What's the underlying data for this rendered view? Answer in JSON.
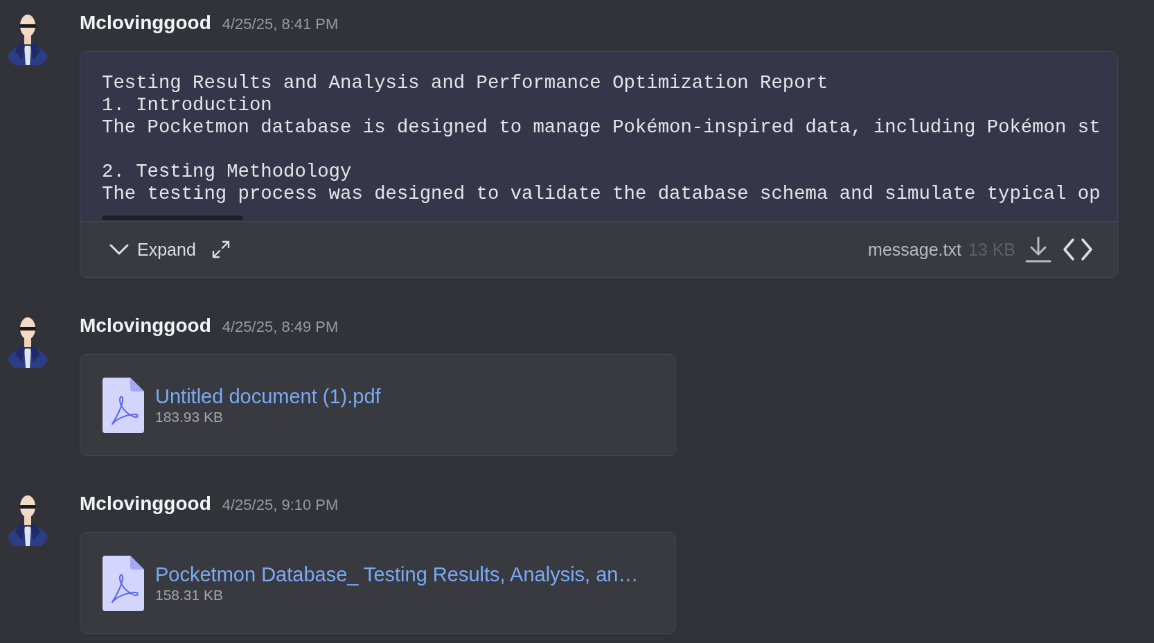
{
  "messages": [
    {
      "author": "Mclovinggood",
      "timestamp": "4/25/25, 8:41 PM",
      "attachment": {
        "kind": "text_preview",
        "sections": [
          {
            "lines": [
              "Testing Results and Analysis and Performance Optimization Report",
              "1. Introduction",
              "The Pocketmon database is designed to manage Pokémon-inspired data, including Pokémon st"
            ]
          },
          {
            "lines": [
              "2. Testing Methodology",
              "The testing process was designed to validate the database schema and simulate typical op"
            ]
          }
        ],
        "expand_label": "Expand",
        "file_name": "message.txt",
        "file_size": "13 KB"
      }
    },
    {
      "author": "Mclovinggood",
      "timestamp": "4/25/25, 8:49 PM",
      "attachment": {
        "kind": "file",
        "file_name": "Untitled document (1).pdf",
        "file_size": "183.93 KB"
      }
    },
    {
      "author": "Mclovinggood",
      "timestamp": "4/25/25, 9:10 PM",
      "attachment": {
        "kind": "file",
        "file_name": "Pocketmon Database_ Testing Results, Analysis, an…",
        "file_size": "158.31 KB"
      }
    }
  ]
}
